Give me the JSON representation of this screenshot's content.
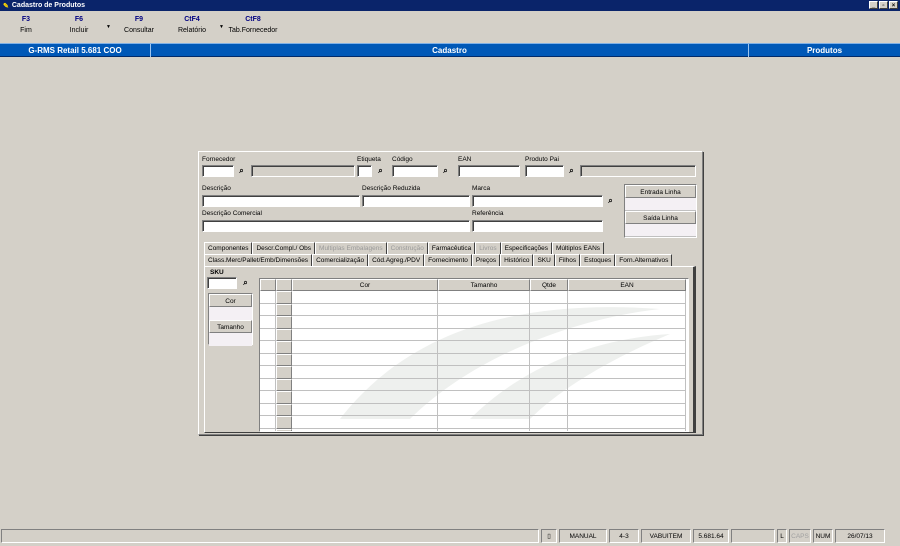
{
  "window": {
    "title": "Cadastro de Produtos"
  },
  "toolbar": {
    "buttons": [
      {
        "key": "F3",
        "label": "Fim"
      },
      {
        "key": "F6",
        "label": "Incluir"
      },
      {
        "key": "F9",
        "label": "Consultar"
      },
      {
        "key": "CtF4",
        "label": "Relatório"
      },
      {
        "key": "CtF8",
        "label": "Tab.Fornecedor"
      }
    ]
  },
  "header": {
    "left": "G-RMS Retail 5.681 COO",
    "center": "Cadastro",
    "right": "Produtos"
  },
  "form": {
    "fornecedor_label": "Fornecedor",
    "etiqueta_label": "Etiqueta",
    "codigo_label": "Código",
    "ean_label": "EAN",
    "produto_pai_label": "Produto Pai",
    "descricao_label": "Descrição",
    "descricao_reduzida_label": "Descrição Reduzida",
    "marca_label": "Marca",
    "descricao_comercial_label": "Descrição Comercial",
    "referencia_label": "Referência",
    "entrada_linha": "Entrada Linha",
    "saida_linha": "Saída Linha"
  },
  "tabs_row1": [
    {
      "label": "Componentes",
      "enabled": true
    },
    {
      "label": "Descr.Compl./ Obs",
      "enabled": true
    },
    {
      "label": "Multiplas Embalagens",
      "enabled": false
    },
    {
      "label": "Construção",
      "enabled": false
    },
    {
      "label": "Farmacêutica",
      "enabled": true
    },
    {
      "label": "Livros",
      "enabled": false
    },
    {
      "label": "Especificações",
      "enabled": true
    },
    {
      "label": "Múltiplos EANs",
      "enabled": true
    }
  ],
  "tabs_row2": [
    {
      "label": "Class.Merc/Pallet/Emb/Dimensões",
      "enabled": true
    },
    {
      "label": "Comercialização",
      "enabled": true
    },
    {
      "label": "Cód.Agreg./PDV",
      "enabled": true
    },
    {
      "label": "Fornecimento",
      "enabled": true
    },
    {
      "label": "Preços",
      "enabled": true
    },
    {
      "label": "Histórico",
      "enabled": true
    },
    {
      "label": "SKU",
      "enabled": true,
      "active": true
    },
    {
      "label": "Filhos",
      "enabled": true
    },
    {
      "label": "Estoques",
      "enabled": true
    },
    {
      "label": "Forn.Alternativos",
      "enabled": true
    }
  ],
  "sku": {
    "title": "SKU",
    "cor_label": "Cor",
    "tamanho_label": "Tamanho",
    "grid_columns": [
      "Cor",
      "Tamanho",
      "Qtde",
      "EAN"
    ],
    "grid_rows": 12
  },
  "statusbar": {
    "mode": "MANUAL",
    "code": "4-3",
    "user": "VABUITEM",
    "version": "5.681.64",
    "l": "L",
    "caps": "CAPS",
    "num": "NUM",
    "date": "26/07/13"
  },
  "colors": {
    "header_blue": "#0058b7",
    "title_blue": "#0a246a",
    "key_blue": "#000080"
  }
}
